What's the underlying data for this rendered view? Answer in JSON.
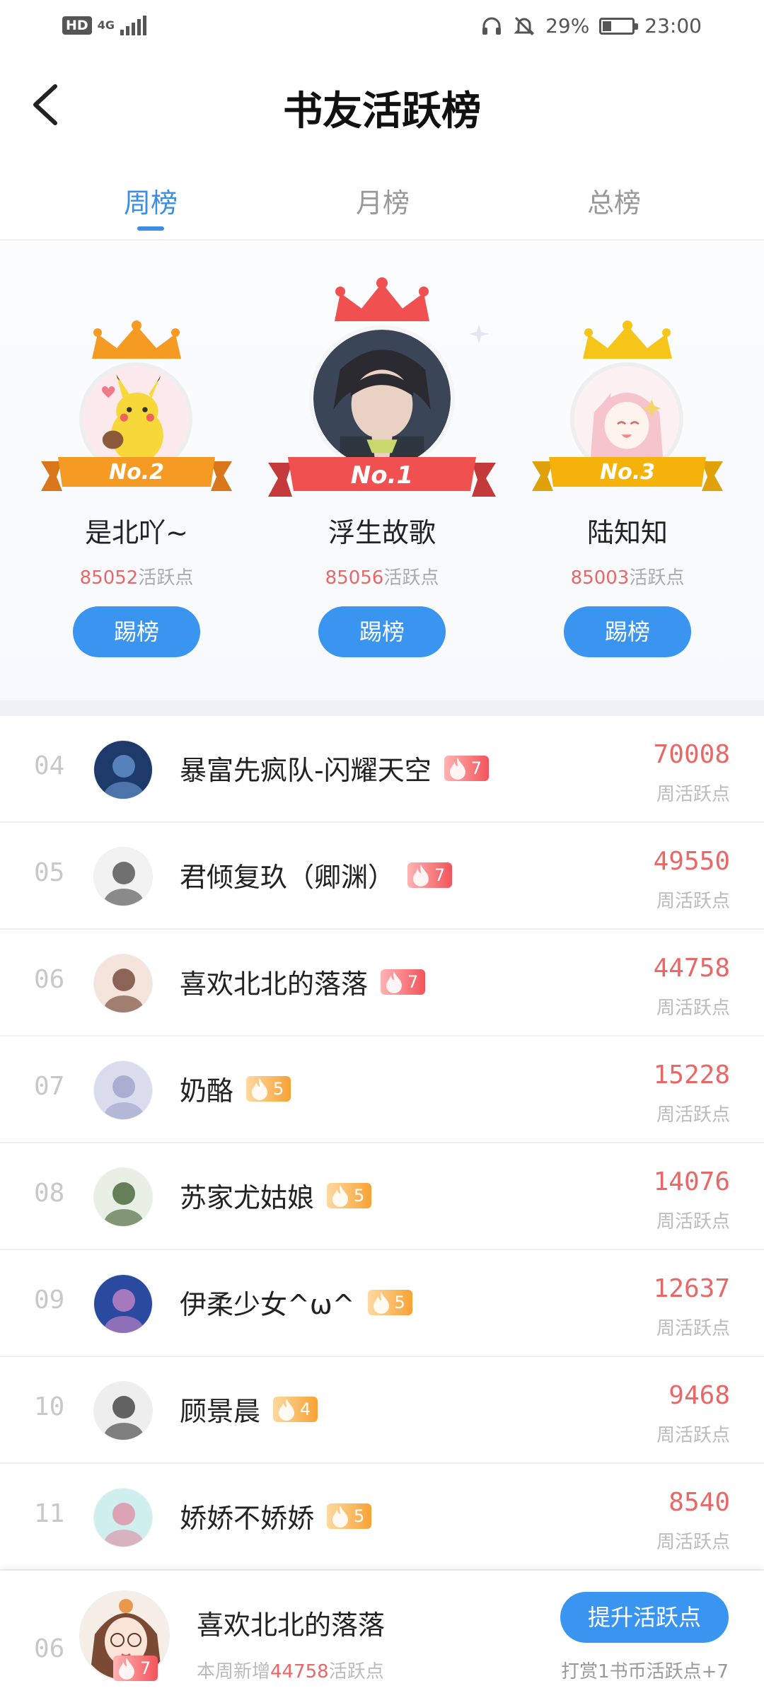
{
  "status_bar": {
    "hd": "HD",
    "network": "4G",
    "battery_text": "29%",
    "battery_level": 0.29,
    "time": "23:00"
  },
  "header": {
    "title": "书友活跃榜"
  },
  "tabs": [
    {
      "label": "周榜",
      "active": true
    },
    {
      "label": "月榜",
      "active": false
    },
    {
      "label": "总榜",
      "active": false
    }
  ],
  "podium": {
    "first": {
      "rank_label": "No.1",
      "name": "浮生故歌",
      "points": "85056",
      "points_suffix": "活跃点",
      "button": "踢榜"
    },
    "second": {
      "rank_label": "No.2",
      "name": "是北吖~",
      "points": "85052",
      "points_suffix": "活跃点",
      "button": "踢榜"
    },
    "third": {
      "rank_label": "No.3",
      "name": "陆知知",
      "points": "85003",
      "points_suffix": "活跃点",
      "button": "踢榜"
    }
  },
  "list": [
    {
      "rank": "04",
      "name": "暴富先疯队-闪耀天空",
      "level": "7",
      "level_color": "red",
      "score": "70008",
      "score_label": "周活跃点"
    },
    {
      "rank": "05",
      "name": "君倾复玖（卿渊）",
      "level": "7",
      "level_color": "red",
      "score": "49550",
      "score_label": "周活跃点"
    },
    {
      "rank": "06",
      "name": "喜欢北北的落落",
      "level": "7",
      "level_color": "red",
      "score": "44758",
      "score_label": "周活跃点"
    },
    {
      "rank": "07",
      "name": "奶酪",
      "level": "5",
      "level_color": "orange",
      "score": "15228",
      "score_label": "周活跃点"
    },
    {
      "rank": "08",
      "name": "苏家尤姑娘",
      "level": "5",
      "level_color": "orange",
      "score": "14076",
      "score_label": "周活跃点"
    },
    {
      "rank": "09",
      "name": "伊柔少女^ω^",
      "level": "5",
      "level_color": "orange",
      "score": "12637",
      "score_label": "周活跃点"
    },
    {
      "rank": "10",
      "name": "顾景晨",
      "level": "4",
      "level_color": "orange",
      "score": "9468",
      "score_label": "周活跃点"
    },
    {
      "rank": "11",
      "name": "娇娇不娇娇",
      "level": "5",
      "level_color": "orange",
      "score": "8540",
      "score_label": "周活跃点"
    }
  ],
  "bottom": {
    "rank": "06",
    "name": "喜欢北北的落落",
    "level": "7",
    "sub_prefix": "本周新增",
    "sub_points": "44758",
    "sub_suffix": "活跃点",
    "button": "提升活跃点",
    "tip": "打赏1书币活跃点+7"
  },
  "colors": {
    "accent": "#3a8ee6",
    "button": "#3a95f0",
    "score": "#e86767",
    "gold": "#f5b20a",
    "silver_orange": "#f59a23",
    "red": "#f05050"
  }
}
